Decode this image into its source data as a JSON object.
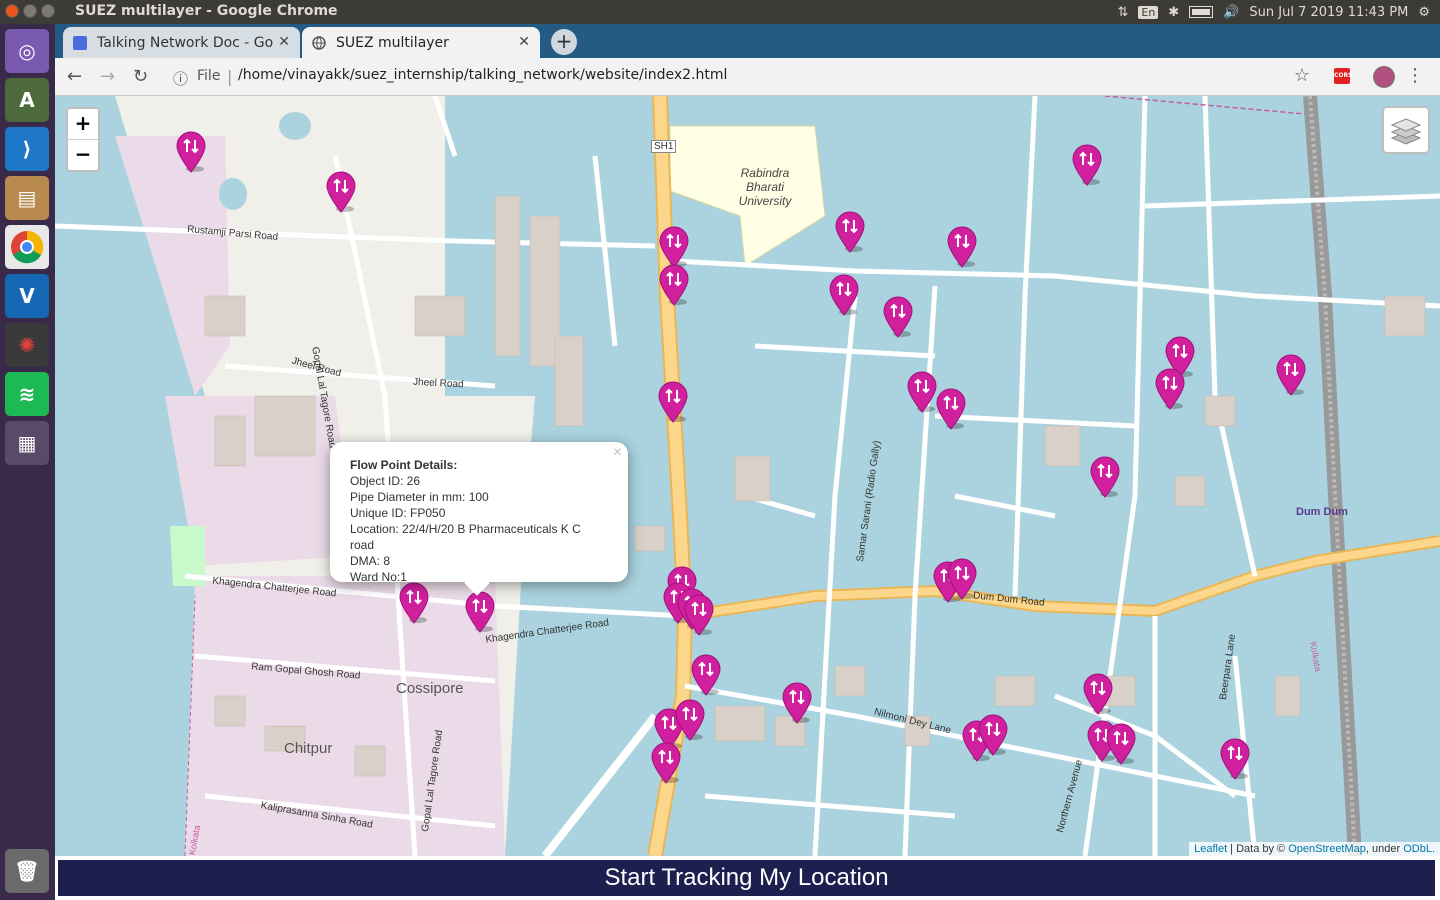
{
  "system": {
    "window_title": "SUEZ multilayer - Google Chrome",
    "lang": "En",
    "clock": "Sun Jul 7 2019 11:43 PM"
  },
  "tabs": [
    {
      "label": "Talking Network Doc - Go",
      "icon": "docs-icon",
      "color": "#4a6ee0"
    },
    {
      "label": "SUEZ multilayer",
      "icon": "globe-icon"
    }
  ],
  "toolbar": {
    "info_label": "File",
    "url": "/home/vinayakk/suez_internship/talking_network/website/index2.html",
    "cors_label": "CORS"
  },
  "map": {
    "zoom_in": "+",
    "zoom_out": "−",
    "labels": {
      "university": "Rabindra Bharati University",
      "sh1": "SH1",
      "rustamji": "Rustamji Parsi Road",
      "jheel1": "Jheel Road",
      "jheel2": "Jheel Road",
      "gopal_top": "Gopal Lal Tagore Road",
      "gopal_bottom": "Gopal Lal Tagore Road",
      "khagendra1": "Khagendra Chatterjee Road",
      "khagendra2": "Khagendra Chatterjee Road",
      "ram_gopal": "Ram Gopal Ghosh Road",
      "cossipore": "Cossipore",
      "chitpur": "Chitpur",
      "kali": "Kaliprasanna Sinha Road",
      "samar": "Samar Sarani (Radio Gally)",
      "dumdum_road": "Dum Dum Road",
      "nilmoni": "Nilmoni Dey Lane",
      "northern": "Northern Avenue",
      "beerpara": "Beerpara Lane",
      "dumdum": "Dum Dum",
      "kolkata1": "Kolkata",
      "kolkata2": "Kolkata"
    },
    "marker_color": "#d1209e",
    "marker_count": 35,
    "attribution": {
      "leaflet": "Leaflet",
      "data_by": " | Data by © ",
      "osm": "OpenStreetMap",
      "under": ", under ",
      "odbl": "ODbL."
    }
  },
  "popup": {
    "title": "Flow Point Details:",
    "close": "×",
    "lines": [
      "Object ID: 26",
      "Pipe Diameter in mm: 100",
      "Unique ID: FP050",
      "Location: 22/4/H/20 B Pharmaceuticals K C road",
      "DMA: 8",
      "Ward No:1"
    ]
  },
  "tracking_button": "Start Tracking My Location"
}
